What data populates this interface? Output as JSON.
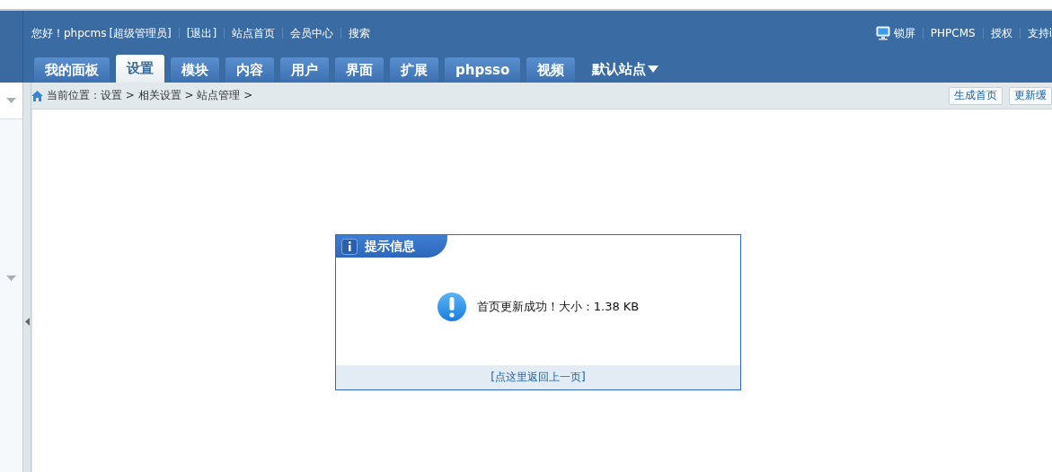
{
  "header": {
    "greeting": "您好！",
    "username": "phpcms",
    "role": "[超级管理员]",
    "links_left": [
      "[退出]",
      "站点首页",
      "会员中心",
      "搜索"
    ],
    "links_right": [
      "锁屏",
      "PHPCMS",
      "授权",
      "支持i"
    ]
  },
  "tabs": [
    {
      "label": "我的面板",
      "selected": false
    },
    {
      "label": "设置",
      "selected": true
    },
    {
      "label": "模块",
      "selected": false
    },
    {
      "label": "内容",
      "selected": false
    },
    {
      "label": "用户",
      "selected": false
    },
    {
      "label": "界面",
      "selected": false
    },
    {
      "label": "扩展",
      "selected": false
    },
    {
      "label": "phpsso",
      "selected": false
    },
    {
      "label": "视频",
      "selected": false
    }
  ],
  "site_menu": "默认站点",
  "breadcrumb": "当前位置：设置 > 相关设置 > 站点管理 >",
  "actions": [
    "生成首页",
    "更新缓"
  ],
  "dialog": {
    "title": "提示信息",
    "message": "首页更新成功！大小：1.38 KB",
    "back_link": "[点这里返回上一页]"
  }
}
